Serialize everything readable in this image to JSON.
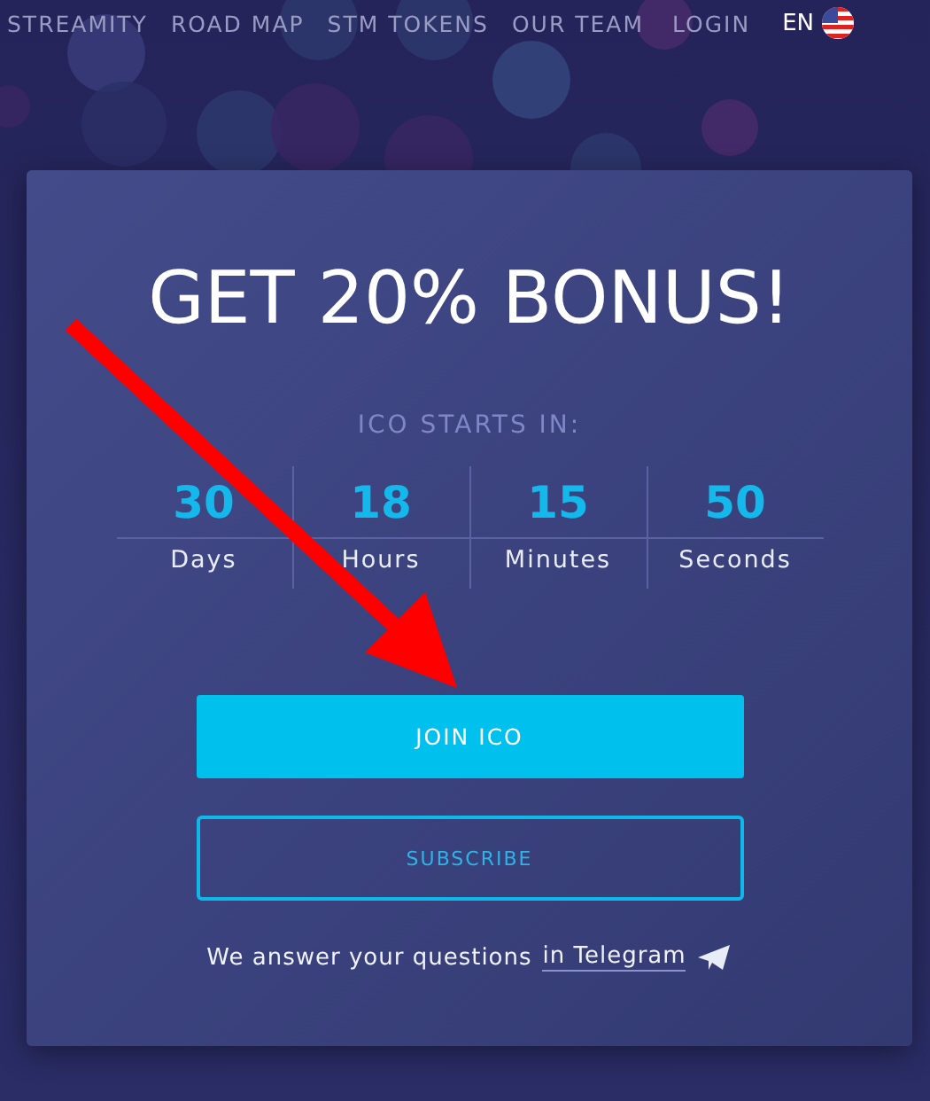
{
  "nav": {
    "items": [
      {
        "label": "STREAMITY"
      },
      {
        "label": "ROAD MAP"
      },
      {
        "label": "STM TOKENS"
      },
      {
        "label": "OUR TEAM"
      },
      {
        "label": "LOGIN"
      }
    ],
    "language": "EN"
  },
  "card": {
    "title": "GET 20% BONUS!",
    "subtitle": "ICO STARTS IN:",
    "countdown": [
      {
        "value": "30",
        "unit": "Days"
      },
      {
        "value": "18",
        "unit": "Hours"
      },
      {
        "value": "15",
        "unit": "Minutes"
      },
      {
        "value": "50",
        "unit": "Seconds"
      }
    ],
    "primary_button": "JOIN ICO",
    "secondary_button": "SUBSCRIBE",
    "note": "We answer your questions",
    "note_link": "in Telegram"
  }
}
